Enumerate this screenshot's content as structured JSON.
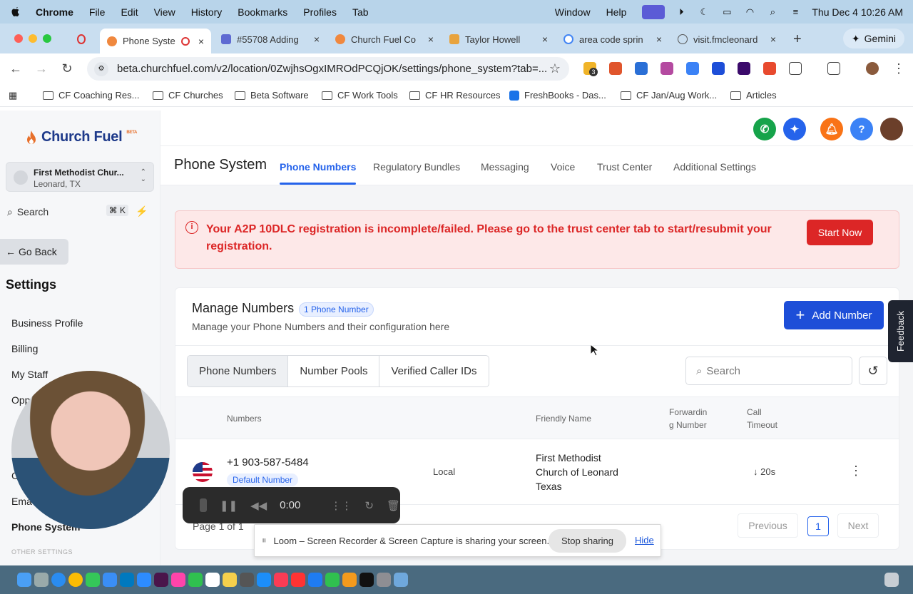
{
  "menubar": {
    "app": "Chrome",
    "items": [
      "File",
      "Edit",
      "View",
      "History",
      "Bookmarks",
      "Profiles",
      "Tab",
      "Window",
      "Help"
    ],
    "datetime": "Thu Dec 4  10:26 AM"
  },
  "tabs": [
    {
      "label": "Phone Syste",
      "active": true
    },
    {
      "label": "#55708 Adding"
    },
    {
      "label": "Church Fuel Co"
    },
    {
      "label": "Taylor Howell"
    },
    {
      "label": "area code sprin"
    },
    {
      "label": "visit.fmcleonard"
    }
  ],
  "gemini_label": "Gemini",
  "url": "beta.churchfuel.com/v2/location/0ZwjhsOgxIMROdPCQjOK/settings/phone_system?tab=...",
  "extension_badge": "3",
  "bookmarks": [
    "CF Coaching Res...",
    "CF Churches",
    "Beta Software",
    "CF Work Tools",
    "CF HR Resources",
    "FreshBooks - Das...",
    "CF Jan/Aug Work...",
    "Articles"
  ],
  "sidebar": {
    "logo": "Church Fuel",
    "beta": "BETA",
    "location_name": "First Methodist Chur...",
    "location_sub": "Leonard, TX",
    "search_label": "Search",
    "search_shortcut": "⌘ K",
    "go_back": "Go Back",
    "settings_heading": "Settings",
    "items": [
      "Business Profile",
      "Billing",
      "My Staff",
      "Opp",
      "C",
      "Ema",
      "Phone System"
    ],
    "other_settings": "OTHER SETTINGS"
  },
  "header": {
    "help": "?"
  },
  "subnav": {
    "title": "Phone System",
    "tabs": [
      "Phone Numbers",
      "Regulatory Bundles",
      "Messaging",
      "Voice",
      "Trust Center",
      "Additional Settings"
    ]
  },
  "alert": {
    "message": "Your A2P 10DLC registration is incomplete/failed. Please go to the trust center tab to start/resubmit your registration.",
    "button": "Start Now"
  },
  "manage": {
    "title": "Manage Numbers",
    "count_badge": "1 Phone Number",
    "subtitle": "Manage your Phone Numbers and their configuration here",
    "add_button": "Add Number",
    "segments": [
      "Phone Numbers",
      "Number Pools",
      "Verified Caller IDs"
    ],
    "search_placeholder": "Search"
  },
  "table": {
    "headers": {
      "numbers": "Numbers",
      "friendly": "Friendly Name",
      "forwarding_1": "Forwardin",
      "forwarding_2": "g Number",
      "timeout_1": "Call",
      "timeout_2": "Timeout"
    },
    "rows": [
      {
        "number": "+1 903-587-5484",
        "badge": "Default Number",
        "type": "Local",
        "friendly_name": "First Methodist Church of Leonard Texas",
        "timeout": "↓ 20s"
      }
    ]
  },
  "pagination": {
    "info": "Page 1 of 1",
    "previous": "Previous",
    "current": "1",
    "next": "Next"
  },
  "feedback": "Feedback",
  "recorder": {
    "time": "0:00"
  },
  "loom": {
    "message": "Loom – Screen Recorder & Screen Capture is sharing your screen.",
    "stop": "Stop sharing",
    "hide": "Hide"
  },
  "colors": {
    "primary": "#1d4ed8",
    "danger": "#dc2626",
    "phone_green": "#16a34a",
    "bell_orange": "#f97316",
    "help_blue": "#3b82f6"
  }
}
